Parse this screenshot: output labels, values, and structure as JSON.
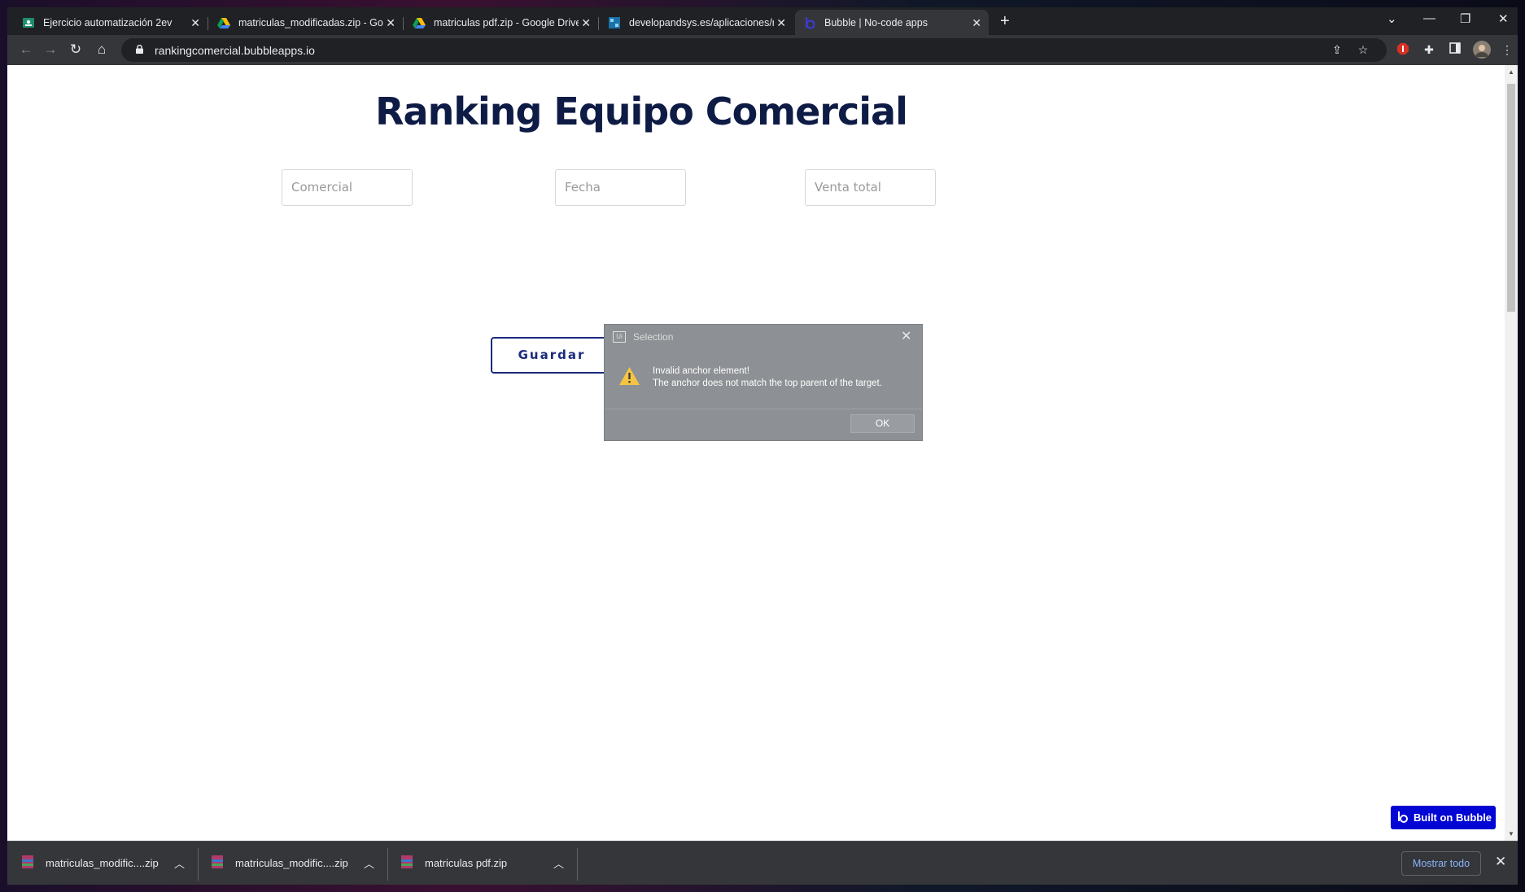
{
  "browser": {
    "tabs": [
      {
        "title": "Ejercicio automatización 2ev",
        "active": false,
        "favicon": "classroom-icon"
      },
      {
        "title": "matriculas_modificadas.zip - Google Drive",
        "active": false,
        "favicon": "google-drive-icon"
      },
      {
        "title": "matriculas pdf.zip - Google Drive",
        "active": false,
        "favicon": "google-drive-icon"
      },
      {
        "title": "developandsys.es/aplicaciones/resultados",
        "active": false,
        "favicon": "site-icon"
      },
      {
        "title": "Bubble | No-code apps",
        "active": true,
        "favicon": "bubble-icon"
      }
    ],
    "url": "rankingcomercial.bubbleapps.io"
  },
  "page": {
    "title": "Ranking Equipo Comercial",
    "fields": {
      "comercial_placeholder": "Comercial",
      "fecha_placeholder": "Fecha",
      "venta_placeholder": "Venta total"
    },
    "save_label": "Guardar",
    "built_on_bubble": "Built on Bubble"
  },
  "dialog": {
    "title": "Selection",
    "message_line1": "Invalid anchor element!",
    "message_line2": "The anchor does not match the top parent of the target.",
    "ok_label": "OK"
  },
  "downloads": {
    "items": [
      {
        "name": "matriculas_modific....zip"
      },
      {
        "name": "matriculas_modific....zip"
      },
      {
        "name": "matriculas pdf.zip"
      }
    ],
    "show_all": "Mostrar todo"
  },
  "colors": {
    "title": "#0d1b45",
    "button_border": "#1b2a7d",
    "bubble_badge": "#0205d3",
    "dialog_bg": "#8d9094"
  }
}
